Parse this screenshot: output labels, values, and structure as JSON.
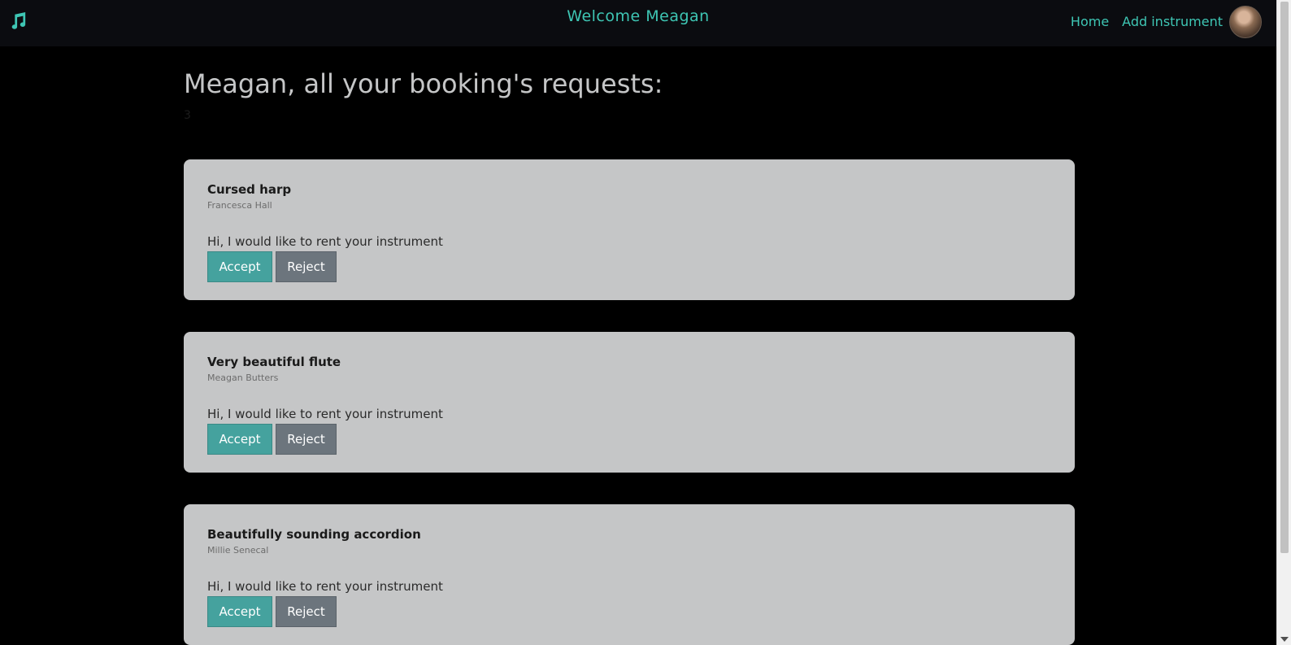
{
  "header": {
    "logo_icon": "music-note-icon",
    "welcome": "Welcome Meagan",
    "nav": {
      "home": "Home",
      "add_instrument": "Add instrument"
    },
    "accent_color": "#3ec6b4"
  },
  "main": {
    "heading": "Meagan, all your booking's requests:",
    "count": "3"
  },
  "requests": [
    {
      "instrument": "Cursed harp",
      "requester": "Francesca Hall",
      "message": "Hi, I would like to rent your instrument",
      "accept_label": "Accept",
      "reject_label": "Reject"
    },
    {
      "instrument": "Very beautiful flute",
      "requester": "Meagan Butters",
      "message": "Hi, I would like to rent your instrument",
      "accept_label": "Accept",
      "reject_label": "Reject"
    },
    {
      "instrument": "Beautifully sounding accordion",
      "requester": "Millie Senecal",
      "message": "Hi, I would like to rent your instrument",
      "accept_label": "Accept",
      "reject_label": "Reject"
    }
  ]
}
